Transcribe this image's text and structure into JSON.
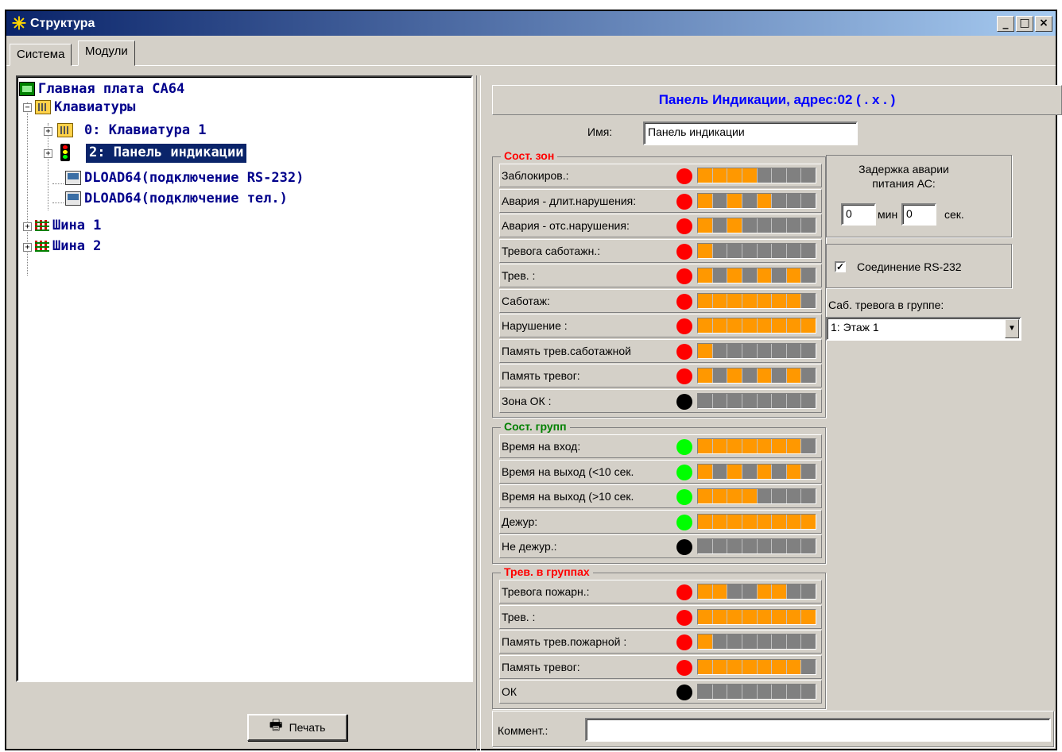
{
  "window": {
    "title": "Структура",
    "minimize": "_",
    "maximize": "□",
    "close": "×"
  },
  "tabs": [
    {
      "label": "Система"
    },
    {
      "label": "Модули"
    }
  ],
  "tree": {
    "root": "Главная плата СА64",
    "keypads": "Клавиатуры",
    "keypad1": "0: Клавиатура 1",
    "panel": "2: Панель индикации",
    "dload_rs": "DLOAD64(подключение RS-232)",
    "dload_tel": "DLOAD64(подключение тел.)",
    "bus1": "Шина 1",
    "bus2": "Шина 2"
  },
  "print_label": "Печать",
  "header": "Панель Индикации, адрес:02 ( . x . )",
  "name_label": "Имя:",
  "name_value": "Панель индикации",
  "colors": {
    "red": "#ff0000",
    "green": "#00ff00",
    "black": "#000000",
    "orange": "#ff9800",
    "group_zone": "#ff0000",
    "group_grp": "#008000",
    "group_alarm": "#ff0000"
  },
  "groups": [
    {
      "title": "Сост. зон",
      "rows": [
        {
          "label": "Заблокиров.:",
          "led": "red",
          "segs": [
            1,
            1,
            1,
            1,
            0,
            0,
            0,
            0
          ]
        },
        {
          "label": "Авария - длит.нарушения:",
          "led": "red",
          "segs": [
            1,
            0,
            1,
            0,
            1,
            0,
            0,
            0
          ]
        },
        {
          "label": "Авария - отс.нарушения:",
          "led": "red",
          "segs": [
            1,
            0,
            1,
            0,
            0,
            0,
            0,
            0
          ]
        },
        {
          "label": "Тревога саботажн.:",
          "led": "red",
          "segs": [
            1,
            0,
            0,
            0,
            0,
            0,
            0,
            0
          ]
        },
        {
          "label": "Трев. :",
          "led": "red",
          "segs": [
            1,
            0,
            1,
            0,
            1,
            0,
            1,
            0
          ]
        },
        {
          "label": "Саботаж:",
          "led": "red",
          "segs": [
            1,
            1,
            1,
            1,
            1,
            1,
            1,
            0
          ]
        },
        {
          "label": "Нарушение :",
          "led": "red",
          "segs": [
            1,
            1,
            1,
            1,
            1,
            1,
            1,
            1
          ]
        },
        {
          "label": "Память трев.саботажной",
          "led": "red",
          "segs": [
            1,
            0,
            0,
            0,
            0,
            0,
            0,
            0
          ]
        },
        {
          "label": "Память тревог:",
          "led": "red",
          "segs": [
            1,
            0,
            1,
            0,
            1,
            0,
            1,
            0
          ]
        },
        {
          "label": "Зона ОК :",
          "led": "black",
          "segs": [
            0,
            0,
            0,
            0,
            0,
            0,
            0,
            0
          ]
        }
      ]
    },
    {
      "title": "Сост. групп",
      "rows": [
        {
          "label": "Время на вход:",
          "led": "green",
          "segs": [
            1,
            1,
            1,
            1,
            1,
            1,
            1,
            0
          ]
        },
        {
          "label": "Время на выход  (<10 сек.",
          "led": "green",
          "segs": [
            1,
            0,
            1,
            0,
            1,
            0,
            1,
            0
          ]
        },
        {
          "label": "Время на выход  (>10 сек.",
          "led": "green",
          "segs": [
            1,
            1,
            1,
            1,
            0,
            0,
            0,
            0
          ]
        },
        {
          "label": "Дежур:",
          "led": "green",
          "segs": [
            1,
            1,
            1,
            1,
            1,
            1,
            1,
            1
          ]
        },
        {
          "label": "Не дежур.:",
          "led": "black",
          "segs": [
            0,
            0,
            0,
            0,
            0,
            0,
            0,
            0
          ]
        }
      ]
    },
    {
      "title": "Трев. в группах",
      "rows": [
        {
          "label": "Тревога пожарн.:",
          "led": "red",
          "segs": [
            1,
            1,
            0,
            0,
            1,
            1,
            0,
            0
          ]
        },
        {
          "label": "Трев. :",
          "led": "red",
          "segs": [
            1,
            1,
            1,
            1,
            1,
            1,
            1,
            1
          ]
        },
        {
          "label": "Память трев.пожарной :",
          "led": "red",
          "segs": [
            1,
            0,
            0,
            0,
            0,
            0,
            0,
            0
          ]
        },
        {
          "label": "Память тревог:",
          "led": "red",
          "segs": [
            1,
            1,
            1,
            1,
            1,
            1,
            1,
            0
          ]
        },
        {
          "label": "ОК",
          "led": "black",
          "segs": [
            0,
            0,
            0,
            0,
            0,
            0,
            0,
            0
          ]
        }
      ]
    }
  ],
  "ac": {
    "title_line1": "Задержка аварии",
    "title_line2": "питания АС:",
    "min_value": "0",
    "min_label": "мин",
    "sec_value": "0",
    "sec_label": "сек."
  },
  "rs232": {
    "label": "Соединение RS-232",
    "checked": "✓"
  },
  "tamper": {
    "label": "Саб. тревога в группе:",
    "value": "1: Этаж 1"
  },
  "comment_label": "Коммент.:"
}
